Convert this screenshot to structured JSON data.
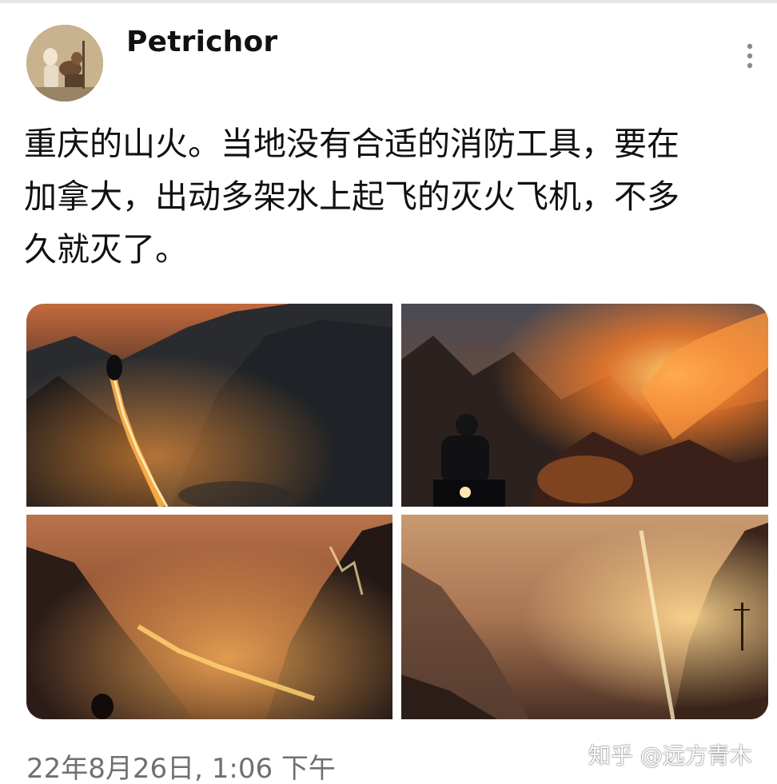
{
  "post": {
    "username": "Petrichor",
    "text_lines": [
      "重庆的山火。当地没有合适的消防工具，要在",
      "加拿大，出动多架水上起飞的灭火飞机，不多",
      "久就灭了。"
    ],
    "timestamp": "22年8月26日, 1:06 下午",
    "photo_count": 4
  },
  "icons": {
    "more": "more-vertical-icon",
    "avatar": "avatar"
  },
  "watermark": {
    "text": "知乎 @远方青木"
  },
  "colors": {
    "text": "#111111",
    "timestamp": "#707070",
    "fire": "#ff8a2a"
  }
}
